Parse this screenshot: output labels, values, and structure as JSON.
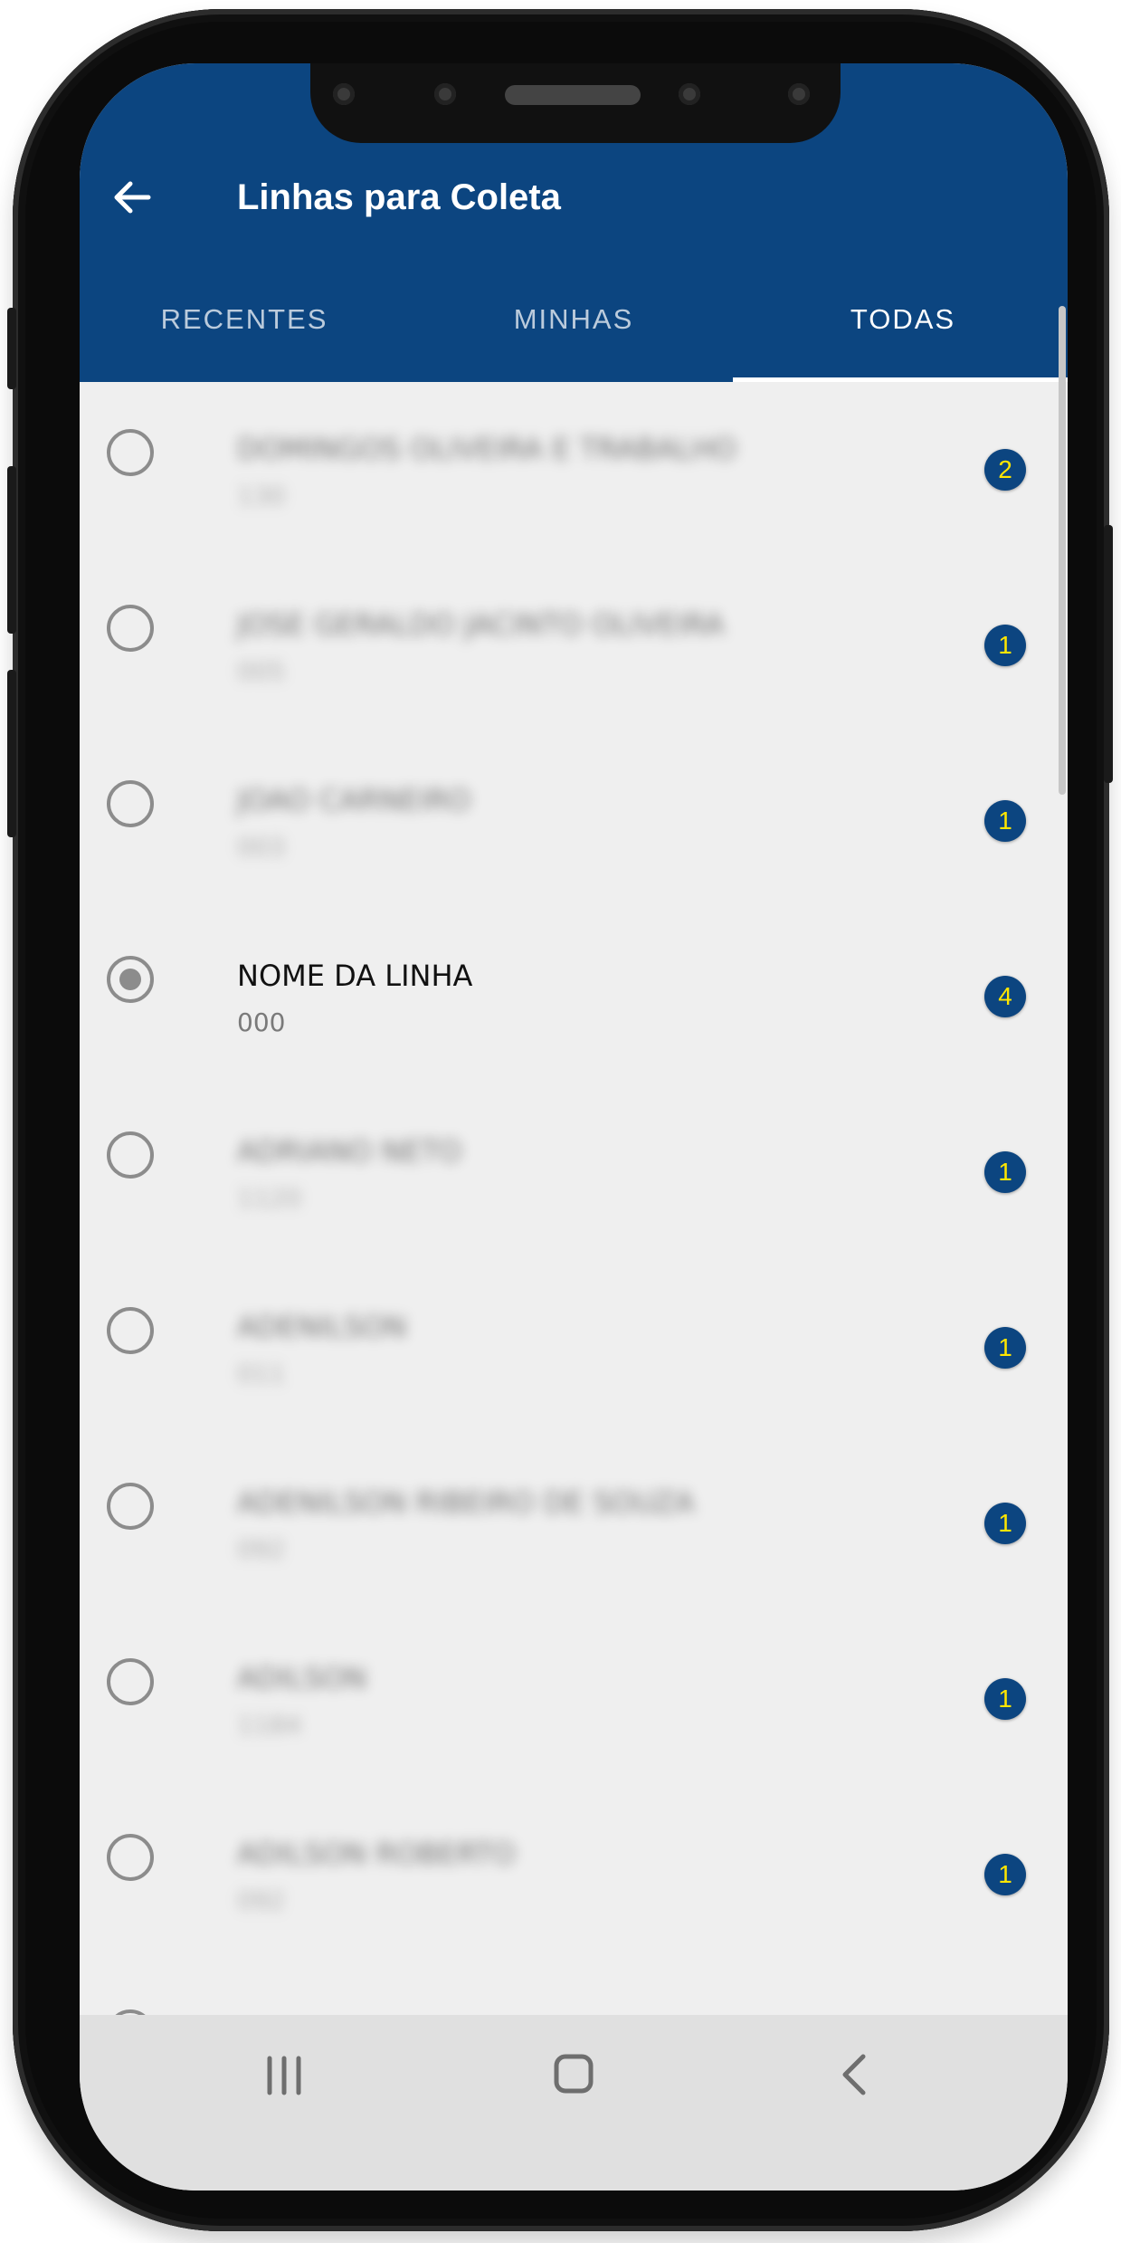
{
  "app_bar": {
    "title": "Linhas para Coleta",
    "back_icon": "arrow-left-icon",
    "background_color": "#0c4580"
  },
  "tabs": [
    {
      "label": "RECENTES",
      "active": false
    },
    {
      "label": "MINHAS",
      "active": false
    },
    {
      "label": "TODAS",
      "active": true
    }
  ],
  "list": {
    "items": [
      {
        "title": "DOMINGOS OLIVEIRA E TRABALHO",
        "code": "130",
        "count": "2",
        "selected": false,
        "obscured": true
      },
      {
        "title": "JOSE GERALDO JACINTO OLIVEIRA",
        "code": "005",
        "count": "1",
        "selected": false,
        "obscured": true
      },
      {
        "title": "JOAO CARNEIRO",
        "code": "003",
        "count": "1",
        "selected": false,
        "obscured": true
      },
      {
        "title": "NOME DA LINHA",
        "code": "000",
        "count": "4",
        "selected": true,
        "obscured": false
      },
      {
        "title": "ADRIANO NETO",
        "code": "1120",
        "count": "1",
        "selected": false,
        "obscured": true
      },
      {
        "title": "ADENILSON",
        "code": "011",
        "count": "1",
        "selected": false,
        "obscured": true
      },
      {
        "title": "ADENILSON RIBEIRO DE SOUZA",
        "code": "092",
        "count": "1",
        "selected": false,
        "obscured": true
      },
      {
        "title": "ADILSON",
        "code": "1184",
        "count": "1",
        "selected": false,
        "obscured": true
      },
      {
        "title": "ADILSON ROBERTO",
        "code": "092",
        "count": "1",
        "selected": false,
        "obscured": true
      }
    ]
  },
  "system_nav": {
    "recents_icon": "recent-apps-icon",
    "home_icon": "home-icon",
    "back_icon": "chevron-left-icon"
  },
  "colors": {
    "badge_background": "#0c4580",
    "badge_text": "#ffe600",
    "list_background": "#efefef"
  }
}
